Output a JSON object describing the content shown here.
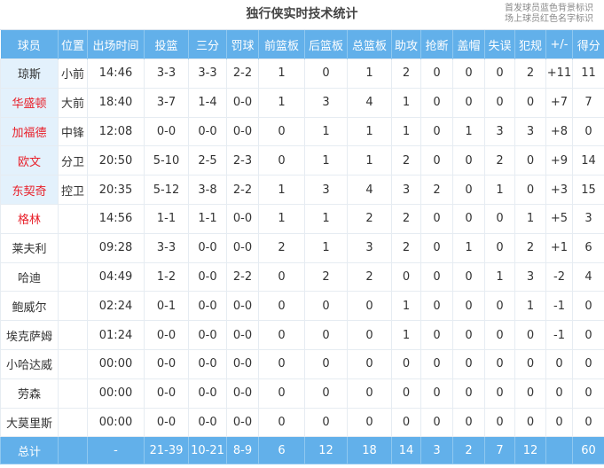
{
  "title": "独行侠实时技术统计",
  "notes": [
    "首发球员蓝色背景标识",
    "场上球员红色名字标识"
  ],
  "colors": {
    "header": "#62b0ea",
    "starter_bg": "#e3f1fc",
    "on_floor_text": "#e8202a"
  },
  "columns": [
    "球员",
    "位置",
    "出场时间",
    "投篮",
    "三分",
    "罚球",
    "前篮板",
    "后篮板",
    "总篮板",
    "助攻",
    "抢断",
    "盖帽",
    "失误",
    "犯规",
    "+/-",
    "得分"
  ],
  "rows": [
    {
      "starter": true,
      "on_floor": false,
      "cells": [
        "琼斯",
        "小前",
        "14:46",
        "3-3",
        "3-3",
        "2-2",
        "1",
        "0",
        "1",
        "2",
        "0",
        "0",
        "0",
        "2",
        "+11",
        "11"
      ]
    },
    {
      "starter": true,
      "on_floor": true,
      "cells": [
        "华盛顿",
        "大前",
        "18:40",
        "3-7",
        "1-4",
        "0-0",
        "1",
        "3",
        "4",
        "1",
        "0",
        "0",
        "0",
        "0",
        "+7",
        "7"
      ]
    },
    {
      "starter": true,
      "on_floor": true,
      "cells": [
        "加福德",
        "中锋",
        "12:08",
        "0-0",
        "0-0",
        "0-0",
        "0",
        "1",
        "1",
        "1",
        "0",
        "1",
        "3",
        "3",
        "+8",
        "0"
      ]
    },
    {
      "starter": true,
      "on_floor": true,
      "cells": [
        "欧文",
        "分卫",
        "20:50",
        "5-10",
        "2-5",
        "2-3",
        "0",
        "1",
        "1",
        "2",
        "0",
        "0",
        "2",
        "0",
        "+9",
        "14"
      ]
    },
    {
      "starter": true,
      "on_floor": true,
      "cells": [
        "东契奇",
        "控卫",
        "20:35",
        "5-12",
        "3-8",
        "2-2",
        "1",
        "3",
        "4",
        "3",
        "2",
        "0",
        "1",
        "0",
        "+3",
        "15"
      ]
    },
    {
      "starter": false,
      "on_floor": true,
      "cells": [
        "格林",
        "",
        "14:56",
        "1-1",
        "1-1",
        "0-0",
        "1",
        "1",
        "2",
        "2",
        "0",
        "0",
        "0",
        "1",
        "+5",
        "3"
      ]
    },
    {
      "starter": false,
      "on_floor": false,
      "cells": [
        "莱夫利",
        "",
        "09:28",
        "3-3",
        "0-0",
        "0-0",
        "2",
        "1",
        "3",
        "2",
        "0",
        "1",
        "0",
        "2",
        "+1",
        "6"
      ]
    },
    {
      "starter": false,
      "on_floor": false,
      "cells": [
        "哈迪",
        "",
        "04:49",
        "1-2",
        "0-0",
        "2-2",
        "0",
        "2",
        "2",
        "0",
        "0",
        "0",
        "1",
        "3",
        "-2",
        "4"
      ]
    },
    {
      "starter": false,
      "on_floor": false,
      "cells": [
        "鲍威尔",
        "",
        "02:24",
        "0-1",
        "0-0",
        "0-0",
        "0",
        "0",
        "0",
        "1",
        "0",
        "0",
        "0",
        "1",
        "-1",
        "0"
      ]
    },
    {
      "starter": false,
      "on_floor": false,
      "cells": [
        "埃克萨姆",
        "",
        "01:24",
        "0-0",
        "0-0",
        "0-0",
        "0",
        "0",
        "0",
        "1",
        "0",
        "0",
        "0",
        "0",
        "-1",
        "0"
      ]
    },
    {
      "starter": false,
      "on_floor": false,
      "cells": [
        "小哈达威",
        "",
        "00:00",
        "0-0",
        "0-0",
        "0-0",
        "0",
        "0",
        "0",
        "0",
        "0",
        "0",
        "0",
        "0",
        "0",
        "0"
      ]
    },
    {
      "starter": false,
      "on_floor": false,
      "cells": [
        "劳森",
        "",
        "00:00",
        "0-0",
        "0-0",
        "0-0",
        "0",
        "0",
        "0",
        "0",
        "0",
        "0",
        "0",
        "0",
        "0",
        "0"
      ]
    },
    {
      "starter": false,
      "on_floor": false,
      "cells": [
        "大莫里斯",
        "",
        "00:00",
        "0-0",
        "0-0",
        "0-0",
        "0",
        "0",
        "0",
        "0",
        "0",
        "0",
        "0",
        "0",
        "0",
        "0"
      ]
    }
  ],
  "totals": [
    "总计",
    "",
    "-",
    "21-39",
    "10-21",
    "8-9",
    "6",
    "12",
    "18",
    "14",
    "3",
    "2",
    "7",
    "12",
    "",
    "60"
  ]
}
